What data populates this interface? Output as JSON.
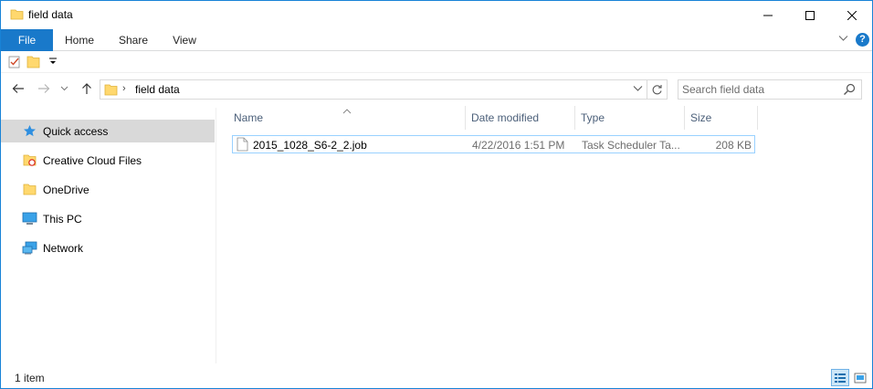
{
  "window": {
    "title": "field data"
  },
  "ribbon": {
    "tabs": [
      {
        "label": "File"
      },
      {
        "label": "Home"
      },
      {
        "label": "Share"
      },
      {
        "label": "View"
      }
    ],
    "help_label": "?"
  },
  "address": {
    "path": "field data"
  },
  "search": {
    "placeholder": "Search field data"
  },
  "nav_pane": {
    "items": [
      {
        "label": "Quick access",
        "icon": "star-icon"
      },
      {
        "label": "Creative Cloud Files",
        "icon": "creative-cloud-folder-icon"
      },
      {
        "label": "OneDrive",
        "icon": "folder-icon"
      },
      {
        "label": "This PC",
        "icon": "computer-icon"
      },
      {
        "label": "Network",
        "icon": "network-icon"
      }
    ]
  },
  "file_list": {
    "columns": [
      "Name",
      "Date modified",
      "Type",
      "Size"
    ],
    "rows": [
      {
        "name": "2015_1028_S6-2_2.job",
        "date": "4/22/2016 1:51 PM",
        "type": "Task Scheduler Ta...",
        "size": "208 KB"
      }
    ]
  },
  "status": {
    "count": "1 item"
  },
  "colors": {
    "accent": "#1979ca",
    "selection": "#d9d9d9",
    "header_text": "#4c607a"
  }
}
